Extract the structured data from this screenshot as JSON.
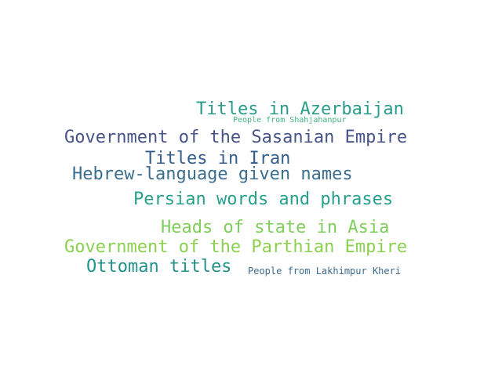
{
  "word_cloud": {
    "words": [
      {
        "text": "Titles in Azerbaijan",
        "color": "#2a9d8a"
      },
      {
        "text": "People from Shahjahanpur",
        "color": "#3fb27f"
      },
      {
        "text": "Government of the Sasanian Empire",
        "color": "#46548a"
      },
      {
        "text": "Titles in Iran",
        "color": "#345e8c"
      },
      {
        "text": "Hebrew-language given names",
        "color": "#3b6e8f"
      },
      {
        "text": "Persian words and phrases",
        "color": "#27a08d"
      },
      {
        "text": "Heads of state in Asia",
        "color": "#7fce5b"
      },
      {
        "text": "Government of the Parthian Empire",
        "color": "#8bd14f"
      },
      {
        "text": "Ottoman titles",
        "color": "#23918c"
      },
      {
        "text": "People from Lakhimpur Kheri",
        "color": "#3c6b8d"
      }
    ]
  }
}
